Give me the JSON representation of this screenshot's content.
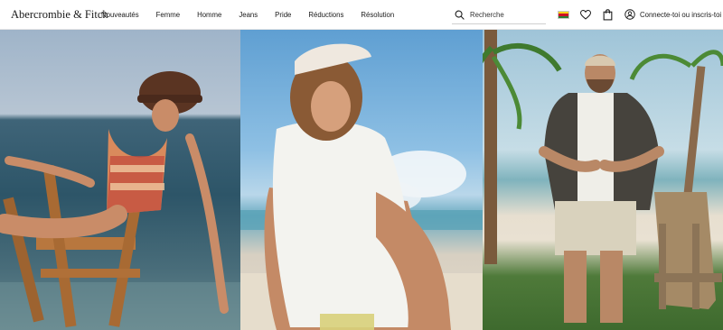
{
  "brand": {
    "name": "Abercrombie & Fitch"
  },
  "nav": {
    "items": [
      "Nouveautés",
      "Femme",
      "Homme",
      "Jeans",
      "Pride",
      "Réductions",
      "Résolution"
    ]
  },
  "search": {
    "placeholder": "Recherche"
  },
  "header": {
    "account_label": "Connecte-toi ou inscris-toi",
    "region_flag": "Colombia-flag"
  },
  "icons": {
    "search": "search-icon",
    "wishlist": "heart-icon",
    "bag": "shopping-bag-icon",
    "account": "user-icon"
  },
  "hero": {
    "panels": [
      {
        "id": "beach-chair-woman",
        "description_color": "#2d5568"
      },
      {
        "id": "woman-sitting-beach",
        "description_color": "#8ec0e4"
      },
      {
        "id": "man-palm-trees",
        "description_color": "#4f7a3a"
      }
    ]
  },
  "colors": {
    "text": "#1a1a1a",
    "border": "#e6e6e6",
    "flag_yellow": "#f7d116",
    "flag_red": "#ce1126",
    "flag_green": "#2e7d32"
  }
}
